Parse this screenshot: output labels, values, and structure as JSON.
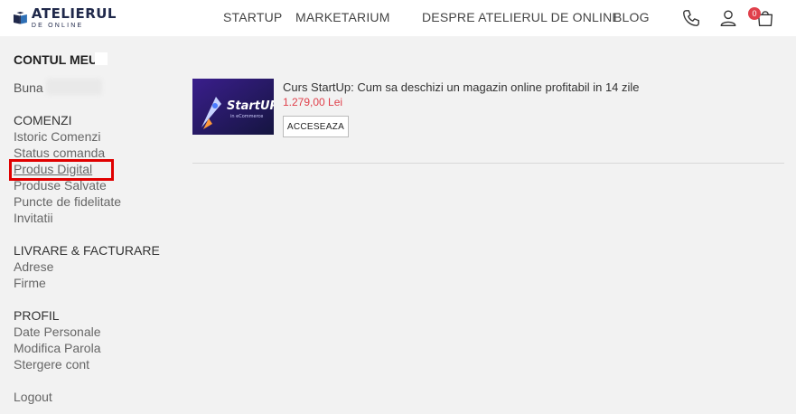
{
  "header": {
    "logo_main": "ATELIERUL",
    "logo_sub": "DE ONLINE",
    "nav": {
      "startup": "STARTUP",
      "marketarium": "MARKETARIUM",
      "despre": "DESPRE ATELIERUL DE ONLINE",
      "blog": "BLOG"
    },
    "cart_count": "0",
    "accent_color": "#e0404b"
  },
  "sidebar": {
    "title": "CONTUL MEU",
    "greeting": "Buna",
    "sections": {
      "comenzi": {
        "heading": "COMENZI",
        "items": [
          "Istoric Comenzi",
          "Status comanda",
          "Produs Digital",
          "Produse Salvate",
          "Puncte de fidelitate",
          "Invitatii"
        ]
      },
      "livrare": {
        "heading": "LIVRARE & FACTURARE",
        "items": [
          "Adrese",
          "Firme"
        ]
      },
      "profil": {
        "heading": "PROFIL",
        "items": [
          "Date Personale",
          "Modifica Parola",
          "Stergere cont"
        ]
      }
    },
    "logout": "Logout"
  },
  "product": {
    "thumb_title": "StartUP",
    "thumb_sub": "in eCommerce",
    "title": "Curs StartUp: Cum sa deschizi un magazin online profitabil in 14 zile",
    "price": "1.279,00 Lei",
    "button": "ACCESEAZA"
  }
}
